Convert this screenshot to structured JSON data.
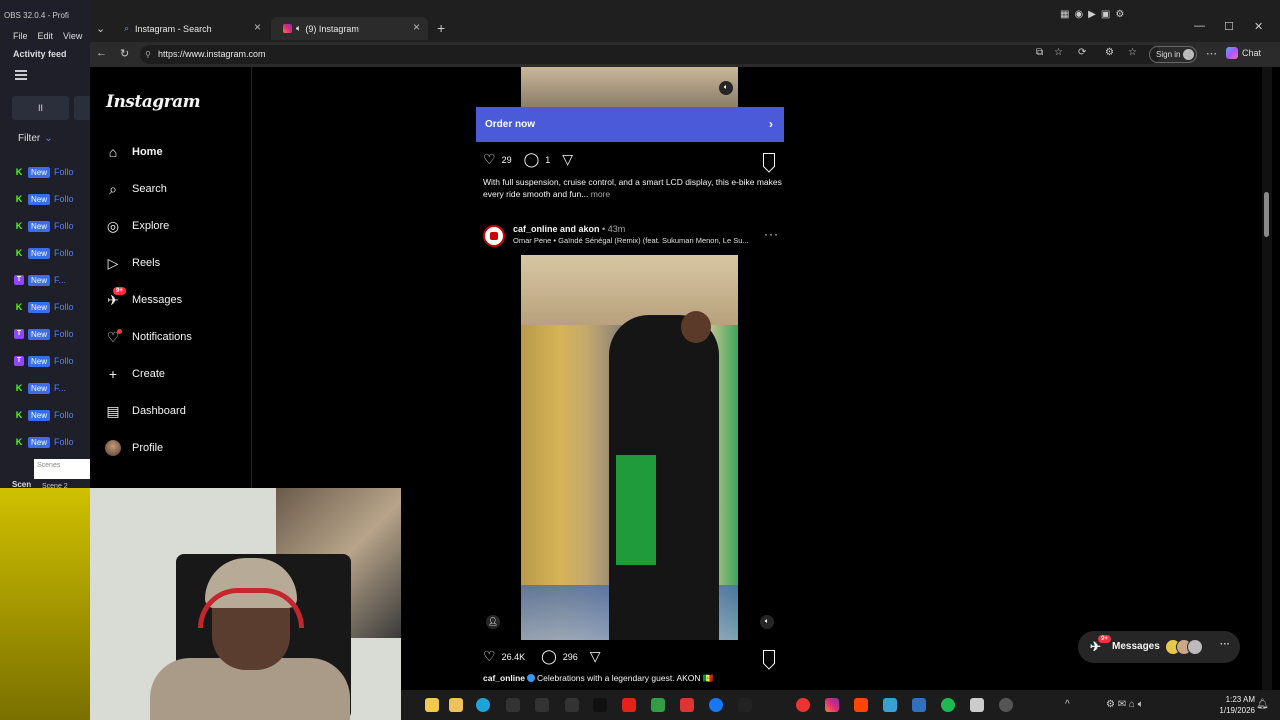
{
  "obs": {
    "title": "OBS 32.0.4 - Profi",
    "menu": [
      "File",
      "Edit",
      "View"
    ],
    "activity_feed": "Activity feed",
    "pause": "II",
    "filter": "Filter",
    "feed": [
      {
        "platform": "K",
        "badge": "New",
        "text": "Follo"
      },
      {
        "platform": "K",
        "badge": "New",
        "text": "Follo"
      },
      {
        "platform": "K",
        "badge": "New",
        "text": "Follo"
      },
      {
        "platform": "K",
        "badge": "New",
        "text": "Follo"
      },
      {
        "platform": "T",
        "badge": "New",
        "text": "F..."
      },
      {
        "platform": "K",
        "badge": "New",
        "text": "Follo"
      },
      {
        "platform": "T",
        "badge": "New",
        "text": "Follo"
      },
      {
        "platform": "T",
        "badge": "New",
        "text": "Follo"
      },
      {
        "platform": "K",
        "badge": "New",
        "text": "F..."
      },
      {
        "platform": "K",
        "badge": "New",
        "text": "Follo"
      },
      {
        "platform": "K",
        "badge": "New",
        "text": "Follo"
      }
    ],
    "scenes_label": "Scen",
    "scenes_popup": "Scenes",
    "scene_item": "Scene 2"
  },
  "browser": {
    "tabs": [
      {
        "title": "Instagram - Search",
        "active": false
      },
      {
        "title": "(9) Instagram",
        "active": true
      }
    ],
    "url": "https://www.instagram.com",
    "signin": "Sign in",
    "chat": "Chat"
  },
  "instagram": {
    "logo": "Instagram",
    "nav": [
      {
        "label": "Home",
        "icon": "home-icon",
        "glyph": "⌂"
      },
      {
        "label": "Search",
        "icon": "search-icon",
        "glyph": "⌕"
      },
      {
        "label": "Explore",
        "icon": "compass-icon",
        "glyph": "◎"
      },
      {
        "label": "Reels",
        "icon": "reels-icon",
        "glyph": "▷"
      },
      {
        "label": "Messages",
        "icon": "messenger-icon",
        "glyph": "✈",
        "badge": "9+"
      },
      {
        "label": "Notifications",
        "icon": "heart-icon",
        "glyph": "♡"
      },
      {
        "label": "Create",
        "icon": "plus-icon",
        "glyph": "+"
      },
      {
        "label": "Dashboard",
        "icon": "dashboard-icon",
        "glyph": "▤"
      },
      {
        "label": "Profile",
        "icon": "avatar",
        "glyph": ""
      }
    ],
    "ad_post": {
      "cta": "Order now",
      "likes": "29",
      "comments": "1",
      "caption": "With full suspension, cruise control, and a smart LCD display, this e-bike makes every ride smooth and fun...",
      "more": "more"
    },
    "post": {
      "users": "caf_online and akon",
      "time": "43m",
      "audio": "Omar Pene • Gaïndé Sénégal (Remix) (feat. Sukumari Menon, Le Su...",
      "likes": "26.4K",
      "comments": "296",
      "caption_user": "caf_online",
      "caption_text": "Celebrations with a legendary guest. AKON 🇸🇳"
    },
    "messages_pill": {
      "label": "Messages",
      "badge": "9+"
    }
  },
  "taskbar": {
    "time": "1:23 AM",
    "date": "1/19/2026"
  }
}
